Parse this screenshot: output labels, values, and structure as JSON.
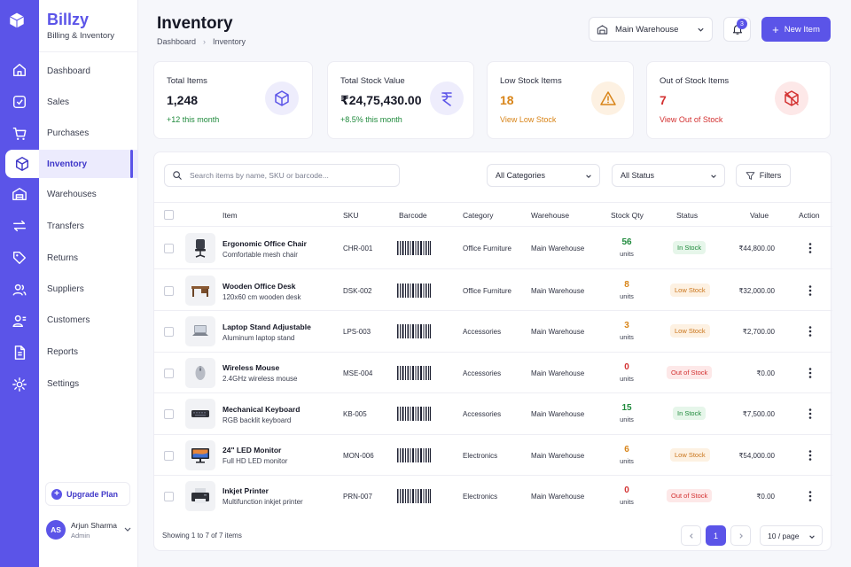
{
  "brand": {
    "name": "Billzy",
    "subtitle": "Billing & Inventory"
  },
  "rail_icons": [
    "box-logo-icon",
    "home-icon",
    "receipt-icon",
    "cart-icon",
    "cube-icon",
    "warehouse-icon",
    "transfer-icon",
    "return-icon",
    "suppliers-icon",
    "customers-icon",
    "reports-icon",
    "settings-icon"
  ],
  "sidebar": {
    "items": [
      {
        "label": "Dashboard"
      },
      {
        "label": "Sales"
      },
      {
        "label": "Purchases"
      },
      {
        "label": "Inventory",
        "active": true
      },
      {
        "label": "Warehouses"
      },
      {
        "label": "Transfers"
      },
      {
        "label": "Returns"
      },
      {
        "label": "Suppliers"
      },
      {
        "label": "Customers"
      },
      {
        "label": "Reports"
      },
      {
        "label": "Settings"
      }
    ],
    "upgrade_label": "Upgrade Plan",
    "user": {
      "initials": "AS",
      "name": "Arjun Sharma",
      "role": "Admin"
    }
  },
  "header": {
    "title": "Inventory",
    "breadcrumb": [
      "Dashboard",
      "Inventory"
    ],
    "warehouse_selected": "Main Warehouse",
    "notification_count": "3",
    "new_item_label": "New Item"
  },
  "stats": [
    {
      "label": "Total Items",
      "value": "1,248",
      "sub": "+12 this month",
      "value_color": "#161826",
      "sub_color": "#1f8a3c",
      "icon": "cube-icon",
      "icon_bg": "#eeedfc",
      "icon_color": "#5b54e8"
    },
    {
      "label": "Total Stock Value",
      "value": "₹24,75,430.00",
      "sub": "+8.5% this month",
      "value_color": "#161826",
      "sub_color": "#1f8a3c",
      "icon": "rupee-icon",
      "icon_bg": "#eeedfc",
      "icon_color": "#5b54e8"
    },
    {
      "label": "Low Stock Items",
      "value": "18",
      "sub": "View Low Stock",
      "value_color": "#d88418",
      "sub_color": "#d88418",
      "icon": "warning-icon",
      "icon_bg": "#fdf1e2",
      "icon_color": "#d88418"
    },
    {
      "label": "Out of Stock Items",
      "value": "7",
      "sub": "View Out of Stock",
      "value_color": "#d33131",
      "sub_color": "#d33131",
      "icon": "box-off-icon",
      "icon_bg": "#fde8e8",
      "icon_color": "#d33131"
    }
  ],
  "toolbar": {
    "search_placeholder": "Search items by name, SKU or barcode...",
    "category_selected": "All Categories",
    "status_selected": "All Status",
    "filters_label": "Filters"
  },
  "table": {
    "columns": [
      "Item",
      "SKU",
      "Barcode",
      "Category",
      "Warehouse",
      "Stock Qty",
      "Status",
      "Value",
      "Action"
    ],
    "rows": [
      {
        "name": "Ergonomic Office Chair",
        "desc": "Comfortable mesh chair",
        "sku": "CHR-001",
        "category": "Office Furniture",
        "warehouse": "Main Warehouse",
        "qty": "56",
        "unit": "units",
        "status": "In Stock",
        "status_kind": "in",
        "value": "₹44,800.00",
        "icon": "chair-icon"
      },
      {
        "name": "Wooden Office Desk",
        "desc": "120x60 cm wooden desk",
        "sku": "DSK-002",
        "category": "Office Furniture",
        "warehouse": "Main Warehouse",
        "qty": "8",
        "unit": "units",
        "status": "Low Stock",
        "status_kind": "low",
        "value": "₹32,000.00",
        "icon": "desk-icon"
      },
      {
        "name": "Laptop Stand Adjustable",
        "desc": "Aluminum laptop stand",
        "sku": "LPS-003",
        "category": "Accessories",
        "warehouse": "Main Warehouse",
        "qty": "3",
        "unit": "units",
        "status": "Low Stock",
        "status_kind": "low",
        "value": "₹2,700.00",
        "icon": "laptop-icon"
      },
      {
        "name": "Wireless Mouse",
        "desc": "2.4GHz wireless mouse",
        "sku": "MSE-004",
        "category": "Accessories",
        "warehouse": "Main Warehouse",
        "qty": "0",
        "unit": "units",
        "status": "Out of Stock",
        "status_kind": "out",
        "value": "₹0.00",
        "icon": "mouse-icon"
      },
      {
        "name": "Mechanical Keyboard",
        "desc": "RGB backlit keyboard",
        "sku": "KB-005",
        "category": "Accessories",
        "warehouse": "Main Warehouse",
        "qty": "15",
        "unit": "units",
        "status": "In Stock",
        "status_kind": "in",
        "value": "₹7,500.00",
        "icon": "keyboard-icon"
      },
      {
        "name": "24\" LED Monitor",
        "desc": "Full HD LED monitor",
        "sku": "MON-006",
        "category": "Electronics",
        "warehouse": "Main Warehouse",
        "qty": "6",
        "unit": "units",
        "status": "Low Stock",
        "status_kind": "low",
        "value": "₹54,000.00",
        "icon": "monitor-icon"
      },
      {
        "name": "Inkjet Printer",
        "desc": "Multifunction inkjet printer",
        "sku": "PRN-007",
        "category": "Electronics",
        "warehouse": "Main Warehouse",
        "qty": "0",
        "unit": "units",
        "status": "Out of Stock",
        "status_kind": "out",
        "value": "₹0.00",
        "icon": "printer-icon"
      }
    ]
  },
  "pagination": {
    "summary": "Showing 1 to 7 of 7 items",
    "current_page": "1",
    "per_page": "10 / page"
  },
  "colors": {
    "accent": "#5b54e8",
    "in_stock": "#1f8a3c",
    "low_stock": "#d88418",
    "out_of_stock": "#d33131"
  }
}
